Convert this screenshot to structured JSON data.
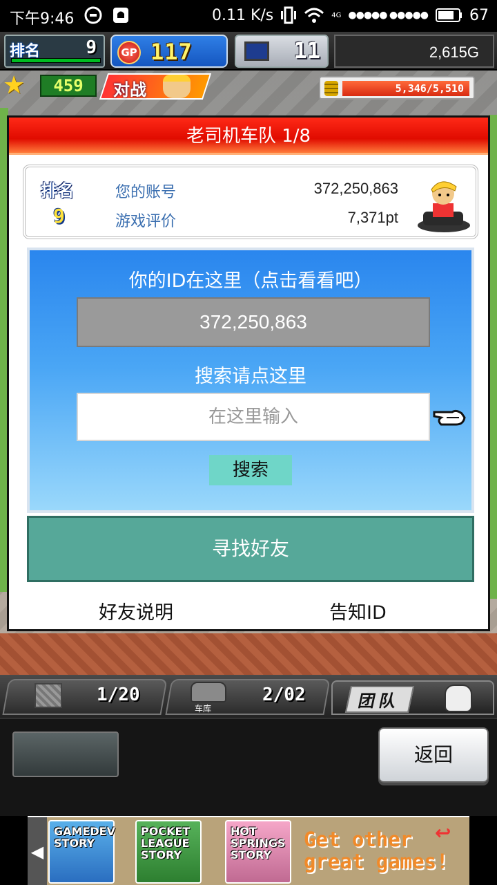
{
  "statusbar": {
    "time": "下午9:46",
    "net_speed": "0.11 K/s",
    "signal_4g": "4G",
    "battery": "67"
  },
  "hud": {
    "rank_label": "排名",
    "rank_value": "9",
    "gp_label": "GP",
    "gp_value": "117",
    "pc_value": "11",
    "money": "2,615G",
    "star_value": "459",
    "battle_label": "对战",
    "hp_text": "5,346/5,510"
  },
  "dialog": {
    "title": "老司机车队 1/8",
    "rank_tag": "排名",
    "rank_num": "9",
    "account_label": "您的账号",
    "account_value": "372,250,863",
    "rating_label": "游戏评价",
    "rating_value": "7,371pt",
    "id_hint": "你的ID在这里（点击看看吧）",
    "id_value": "372,250,863",
    "search_hint": "搜索请点这里",
    "search_placeholder": "在这里输入",
    "search_button": "搜索",
    "find_friend_button": "寻找好友",
    "friend_help_link": "好友说明",
    "notify_id_link": "告知ID"
  },
  "tabs": {
    "box_count": "1/20",
    "garage_label": "车库",
    "garage_count": "2/02",
    "team_label": "团队"
  },
  "bottom": {
    "back_button": "返回"
  },
  "ad": {
    "games": [
      {
        "title": "GAMEDEV STORY"
      },
      {
        "title": "POCKET LEAGUE STORY"
      },
      {
        "title": "HOT SPRINGS STORY"
      }
    ],
    "cta_line1": "Get other",
    "cta_line2": "great games!"
  },
  "colors": {
    "title_red": "#e00b00",
    "panel_blue": "#2a86ee",
    "find_green": "#56a899",
    "search_btn": "#6fd6c8",
    "hp_red": "#d82b12"
  }
}
